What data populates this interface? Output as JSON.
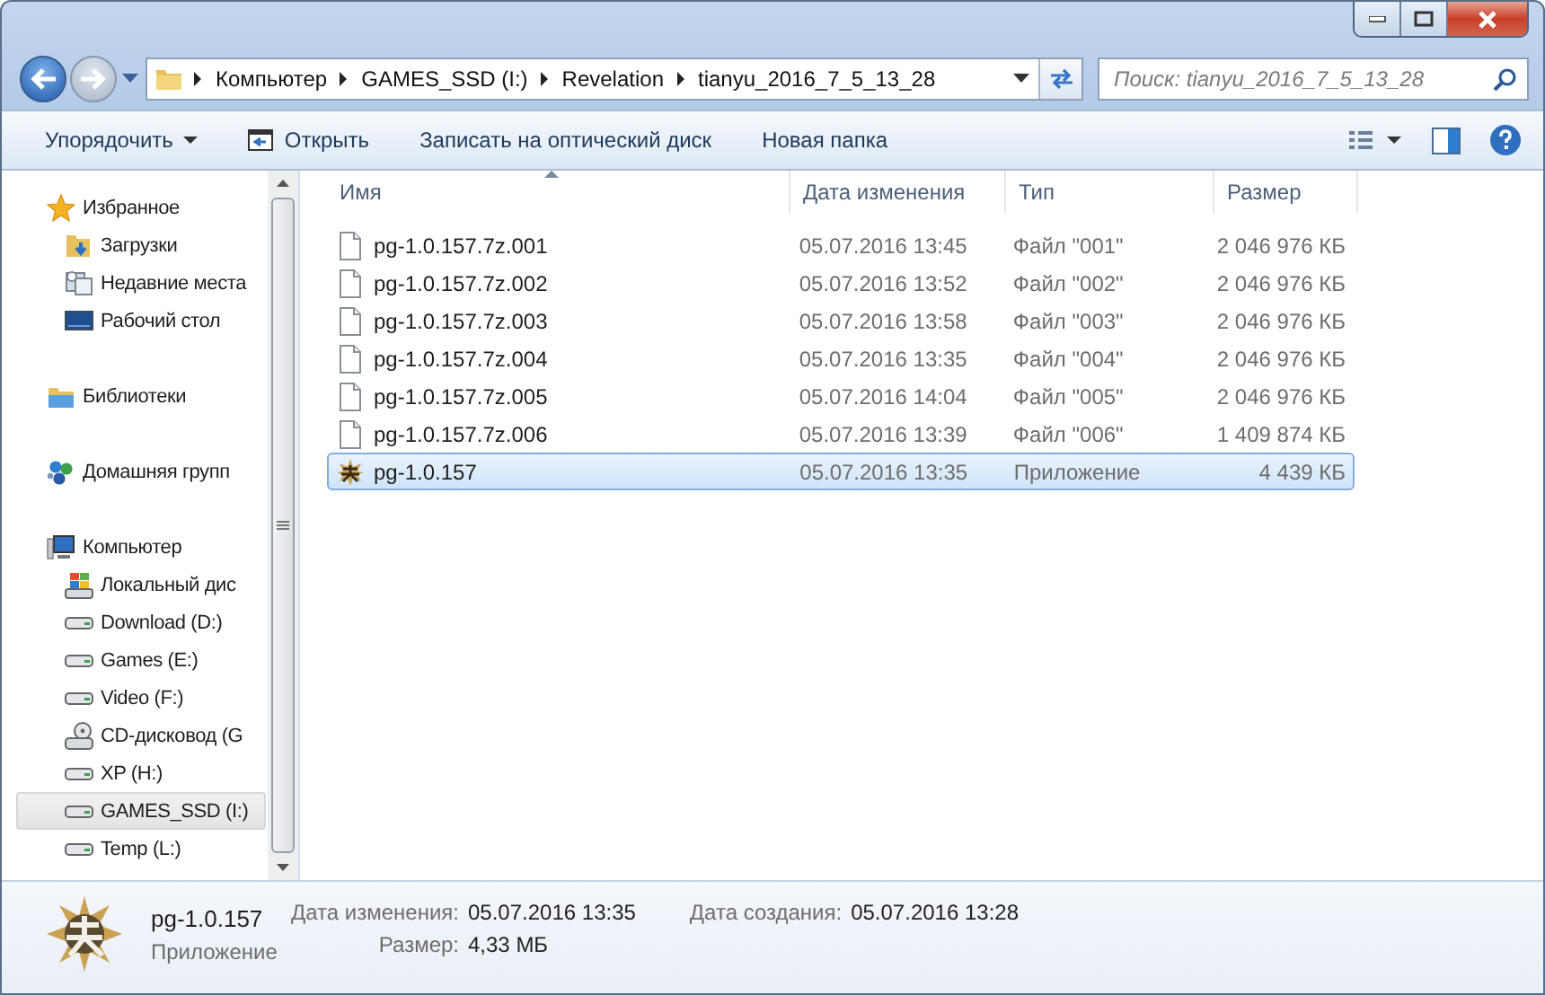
{
  "address": {
    "crumbs": [
      "Компьютер",
      "GAMES_SSD (I:)",
      "Revelation",
      "tianyu_2016_7_5_13_28"
    ]
  },
  "search": {
    "placeholder": "Поиск: tianyu_2016_7_5_13_28"
  },
  "toolbar": [
    {
      "label": "Упорядочить",
      "kind": "menu"
    },
    {
      "label": "Открыть",
      "kind": "open"
    },
    {
      "label": "Записать на оптический диск",
      "kind": "plain"
    },
    {
      "label": "Новая папка",
      "kind": "plain"
    }
  ],
  "sidebar": {
    "items": [
      {
        "label": "Избранное",
        "kind": "star",
        "selected": false,
        "children": [
          {
            "label": "Загрузки",
            "kind": "downloads",
            "selected": false
          },
          {
            "label": "Недавние места",
            "kind": "recent",
            "selected": false
          },
          {
            "label": "Рабочий стол",
            "kind": "desktop",
            "selected": false
          }
        ]
      },
      {
        "label": "Библиотеки",
        "kind": "library",
        "selected": false
      },
      {
        "label": "Домашняя групп",
        "kind": "homegroup",
        "selected": false
      },
      {
        "label": "Компьютер",
        "kind": "computer",
        "selected": false,
        "children": [
          {
            "label": "Локальный дис",
            "kind": "windrive",
            "selected": false
          },
          {
            "label": "Download (D:)",
            "kind": "drive",
            "selected": false
          },
          {
            "label": "Games (E:)",
            "kind": "drive",
            "selected": false
          },
          {
            "label": "Video (F:)",
            "kind": "drive",
            "selected": false
          },
          {
            "label": "CD-дисковод (G",
            "kind": "cd",
            "selected": false
          },
          {
            "label": "XP (H:)",
            "kind": "drive",
            "selected": false
          },
          {
            "label": "GAMES_SSD (I:)",
            "kind": "drive",
            "selected": true
          },
          {
            "label": "Temp (L:)",
            "kind": "drive",
            "selected": false
          }
        ]
      }
    ]
  },
  "table": {
    "columns": [
      {
        "label": "Имя",
        "sorted": true
      },
      {
        "label": "Дата изменения",
        "sorted": false
      },
      {
        "label": "Тип",
        "sorted": false
      },
      {
        "label": "Размер",
        "sorted": false
      }
    ],
    "rows": [
      {
        "name": "pg-1.0.157.7z.001",
        "date": "05.07.2016 13:45",
        "type": "Файл \"001\"",
        "size": "2 046 976 КБ",
        "kind": "file",
        "selected": false
      },
      {
        "name": "pg-1.0.157.7z.002",
        "date": "05.07.2016 13:52",
        "type": "Файл \"002\"",
        "size": "2 046 976 КБ",
        "kind": "file",
        "selected": false
      },
      {
        "name": "pg-1.0.157.7z.003",
        "date": "05.07.2016 13:58",
        "type": "Файл \"003\"",
        "size": "2 046 976 КБ",
        "kind": "file",
        "selected": false
      },
      {
        "name": "pg-1.0.157.7z.004",
        "date": "05.07.2016 13:35",
        "type": "Файл \"004\"",
        "size": "2 046 976 КБ",
        "kind": "file",
        "selected": false
      },
      {
        "name": "pg-1.0.157.7z.005",
        "date": "05.07.2016 14:04",
        "type": "Файл \"005\"",
        "size": "2 046 976 КБ",
        "kind": "file",
        "selected": false
      },
      {
        "name": "pg-1.0.157.7z.006",
        "date": "05.07.2016 13:39",
        "type": "Файл \"006\"",
        "size": "1 409 874 КБ",
        "kind": "file",
        "selected": false
      },
      {
        "name": "pg-1.0.157",
        "date": "05.07.2016 13:35",
        "type": "Приложение",
        "size": "4 439 КБ",
        "kind": "app",
        "selected": true
      }
    ]
  },
  "details": {
    "name": "pg-1.0.157",
    "type": "Приложение",
    "groups": [
      [
        {
          "label": "Дата изменения:",
          "value": "05.07.2016 13:35"
        },
        {
          "label": "Размер:",
          "value": "4,33 МБ"
        }
      ],
      [
        {
          "label": "Дата создания:",
          "value": "05.07.2016 13:28"
        }
      ]
    ]
  }
}
